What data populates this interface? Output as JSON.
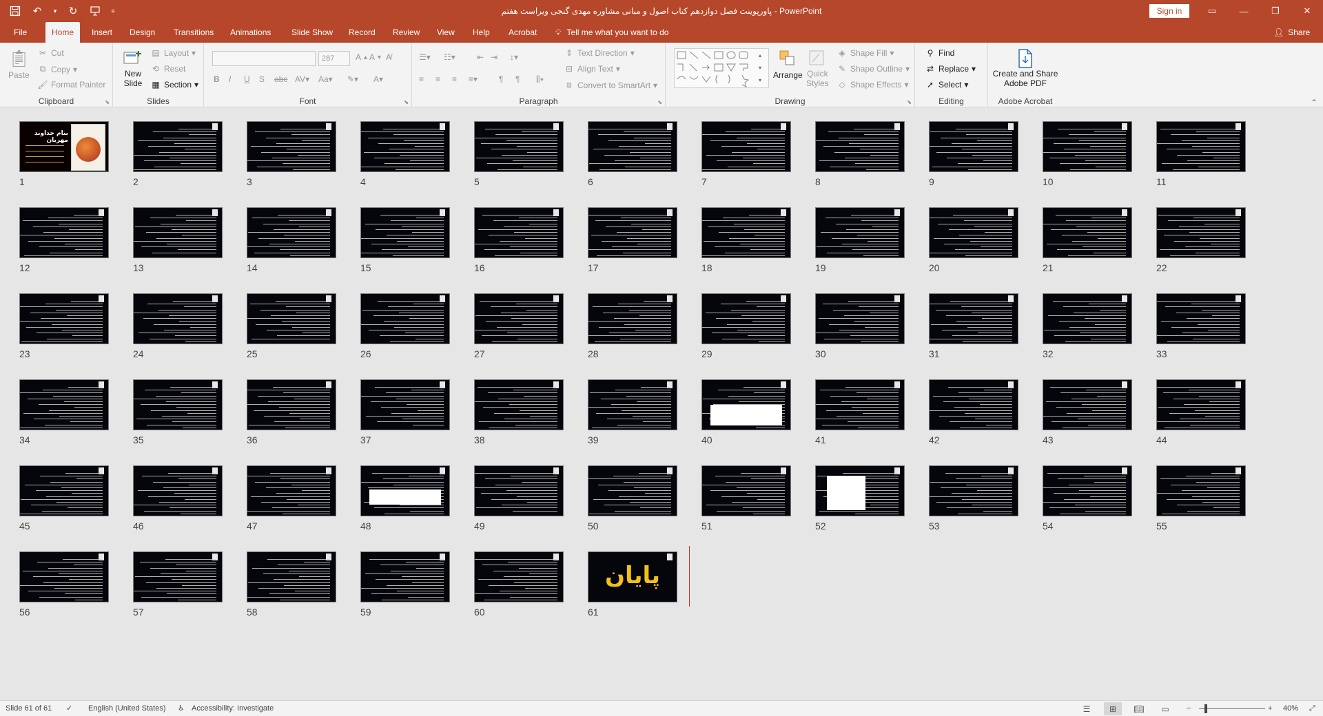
{
  "window": {
    "title": "پاورپوینت فصل دوازدهم کتاب اصول و مبانی مشاوره مهدی گنجی ویراست هفتم  -  PowerPoint",
    "sign_in": "Sign in"
  },
  "tabs": [
    {
      "label": "File"
    },
    {
      "label": "Home"
    },
    {
      "label": "Insert"
    },
    {
      "label": "Design"
    },
    {
      "label": "Transitions"
    },
    {
      "label": "Animations"
    },
    {
      "label": "Slide Show"
    },
    {
      "label": "Record"
    },
    {
      "label": "Review"
    },
    {
      "label": "View"
    },
    {
      "label": "Help"
    },
    {
      "label": "Acrobat"
    }
  ],
  "tell_me": "Tell me what you want to do",
  "share": "Share",
  "ribbon": {
    "clipboard": {
      "label": "Clipboard",
      "paste": "Paste",
      "cut": "Cut",
      "copy": "Copy",
      "format_painter": "Format Painter"
    },
    "slides": {
      "label": "Slides",
      "new_slide_1": "New",
      "new_slide_2": "Slide",
      "layout": "Layout",
      "reset": "Reset",
      "section": "Section"
    },
    "font": {
      "label": "Font",
      "size": "287"
    },
    "paragraph": {
      "label": "Paragraph",
      "text_direction": "Text Direction",
      "align_text": "Align Text",
      "convert_smartart": "Convert to SmartArt"
    },
    "drawing": {
      "label": "Drawing",
      "arrange": "Arrange",
      "quick_styles_1": "Quick",
      "quick_styles_2": "Styles",
      "shape_fill": "Shape Fill",
      "shape_outline": "Shape Outline",
      "shape_effects": "Shape Effects"
    },
    "editing": {
      "label": "Editing",
      "find": "Find",
      "replace": "Replace",
      "select": "Select"
    },
    "acrobat": {
      "label": "Adobe Acrobat",
      "create_1": "Create and Share",
      "create_2": "Adobe PDF"
    }
  },
  "slides": {
    "count": 61,
    "numbers": [
      "1",
      "2",
      "3",
      "4",
      "5",
      "6",
      "7",
      "8",
      "9",
      "10",
      "11",
      "12",
      "13",
      "14",
      "15",
      "16",
      "17",
      "18",
      "19",
      "20",
      "21",
      "22",
      "23",
      "24",
      "25",
      "26",
      "27",
      "28",
      "29",
      "30",
      "31",
      "32",
      "33",
      "34",
      "35",
      "36",
      "37",
      "38",
      "39",
      "40",
      "41",
      "42",
      "43",
      "44",
      "45",
      "46",
      "47",
      "48",
      "49",
      "50",
      "51",
      "52",
      "53",
      "54",
      "55",
      "56",
      "57",
      "58",
      "59",
      "60",
      "61"
    ],
    "first_slide_title": "بنام خداوند مهربان",
    "final_slide_text": "پایان",
    "selected": "61"
  },
  "statusbar": {
    "slide_info": "Slide 61 of 61",
    "language": "English (United States)",
    "accessibility": "Accessibility: Investigate",
    "zoom": "40%"
  },
  "colors": {
    "accent": "#b7472a",
    "final_slide_text": "#f2c118",
    "slide_bg": "#05060c"
  }
}
